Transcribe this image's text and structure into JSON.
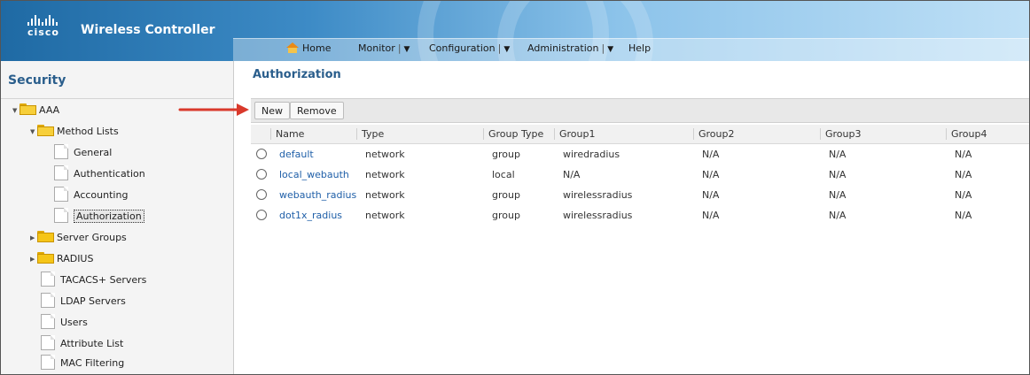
{
  "header": {
    "brand": "cisco",
    "title": "Wireless Controller",
    "nav": [
      {
        "label": "Home",
        "icon": "home-icon",
        "dropdown": false
      },
      {
        "label": "Monitor",
        "dropdown": true
      },
      {
        "label": "Configuration",
        "dropdown": true
      },
      {
        "label": "Administration",
        "dropdown": true
      },
      {
        "label": "Help",
        "dropdown": false
      }
    ]
  },
  "sidebar": {
    "title": "Security",
    "items": [
      {
        "label": "AAA",
        "icon": "folder-open-icon"
      },
      {
        "label": "Method Lists",
        "icon": "folder-open-icon"
      },
      {
        "label": "General",
        "icon": "document-icon"
      },
      {
        "label": "Authentication",
        "icon": "document-icon"
      },
      {
        "label": "Accounting",
        "icon": "document-icon"
      },
      {
        "label": "Authorization",
        "icon": "document-icon",
        "selected": true
      },
      {
        "label": "Server Groups",
        "icon": "folder-icon"
      },
      {
        "label": "RADIUS",
        "icon": "folder-icon"
      },
      {
        "label": "TACACS+ Servers",
        "icon": "document-icon"
      },
      {
        "label": "LDAP Servers",
        "icon": "document-icon"
      },
      {
        "label": "Users",
        "icon": "document-icon"
      },
      {
        "label": "Attribute List",
        "icon": "document-icon"
      },
      {
        "label": "MAC Filtering",
        "icon": "document-icon"
      }
    ]
  },
  "main": {
    "title": "Authorization",
    "toolbar": {
      "new_label": "New",
      "remove_label": "Remove"
    },
    "table": {
      "columns": [
        "Name",
        "Type",
        "Group Type",
        "Group1",
        "Group2",
        "Group3",
        "Group4"
      ],
      "rows": [
        [
          "default",
          "network",
          "group",
          "wiredradius",
          "N/A",
          "N/A",
          "N/A"
        ],
        [
          "local_webauth",
          "network",
          "local",
          "N/A",
          "N/A",
          "N/A",
          "N/A"
        ],
        [
          "webauth_radius",
          "network",
          "group",
          "wirelessradius",
          "N/A",
          "N/A",
          "N/A"
        ],
        [
          "dot1x_radius",
          "network",
          "group",
          "wirelessradius",
          "N/A",
          "N/A",
          "N/A"
        ]
      ]
    }
  },
  "colors": {
    "section_title": "#2a5e8c",
    "link": "#1f5fa8",
    "annotation_arrow": "#d9392b"
  }
}
